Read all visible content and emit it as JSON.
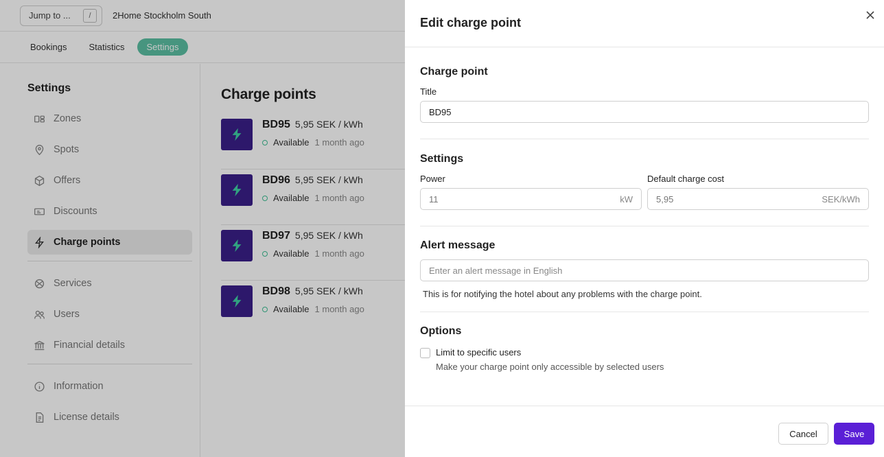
{
  "topbar": {
    "jump_label": "Jump to ...",
    "jump_shortcut": "/",
    "property_name": "2Home Stockholm South"
  },
  "nav": {
    "tabs": [
      {
        "label": "Bookings"
      },
      {
        "label": "Statistics"
      },
      {
        "label": "Settings"
      }
    ],
    "active": "Settings"
  },
  "sidebar": {
    "title": "Settings",
    "group1": [
      {
        "label": "Zones",
        "icon": "zones-icon"
      },
      {
        "label": "Spots",
        "icon": "location-pin-icon"
      },
      {
        "label": "Offers",
        "icon": "box-icon"
      },
      {
        "label": "Discounts",
        "icon": "ticket-icon"
      },
      {
        "label": "Charge points",
        "icon": "lightning-icon"
      }
    ],
    "group2": [
      {
        "label": "Services",
        "icon": "services-icon"
      },
      {
        "label": "Users",
        "icon": "users-icon"
      },
      {
        "label": "Financial details",
        "icon": "bank-icon"
      }
    ],
    "group3": [
      {
        "label": "Information",
        "icon": "info-icon"
      },
      {
        "label": "License details",
        "icon": "document-icon"
      }
    ]
  },
  "main": {
    "title": "Charge points",
    "charge_points": [
      {
        "name": "BD95",
        "price": "5,95 SEK / kWh",
        "status": "Available",
        "time": "1 month ago"
      },
      {
        "name": "BD96",
        "price": "5,95 SEK / kWh",
        "status": "Available",
        "time": "1 month ago"
      },
      {
        "name": "BD97",
        "price": "5,95 SEK / kWh",
        "status": "Available",
        "time": "1 month ago"
      },
      {
        "name": "BD98",
        "price": "5,95 SEK / kWh",
        "status": "Available",
        "time": "1 month ago"
      }
    ]
  },
  "drawer": {
    "title": "Edit charge point",
    "charge_point": {
      "heading": "Charge point",
      "title_label": "Title",
      "title_value": "BD95"
    },
    "settings": {
      "heading": "Settings",
      "power_label": "Power",
      "power_value": "11",
      "power_unit": "kW",
      "cost_label": "Default charge cost",
      "cost_value": "5,95",
      "cost_unit": "SEK/kWh"
    },
    "alert": {
      "heading": "Alert message",
      "placeholder": "Enter an alert message in English",
      "help": "This is for notifying the hotel about any problems with the charge point."
    },
    "options": {
      "heading": "Options",
      "limit_label": "Limit to specific users",
      "limit_help": "Make your charge point only accessible by selected users",
      "limit_checked": false
    },
    "cancel_label": "Cancel",
    "save_label": "Save"
  },
  "colors": {
    "accent": "#5a1fd6",
    "nav_active": "#5cbfa3",
    "cp_icon_bg": "#3a1f8a",
    "cp_bolt": "#3fd0a4"
  }
}
